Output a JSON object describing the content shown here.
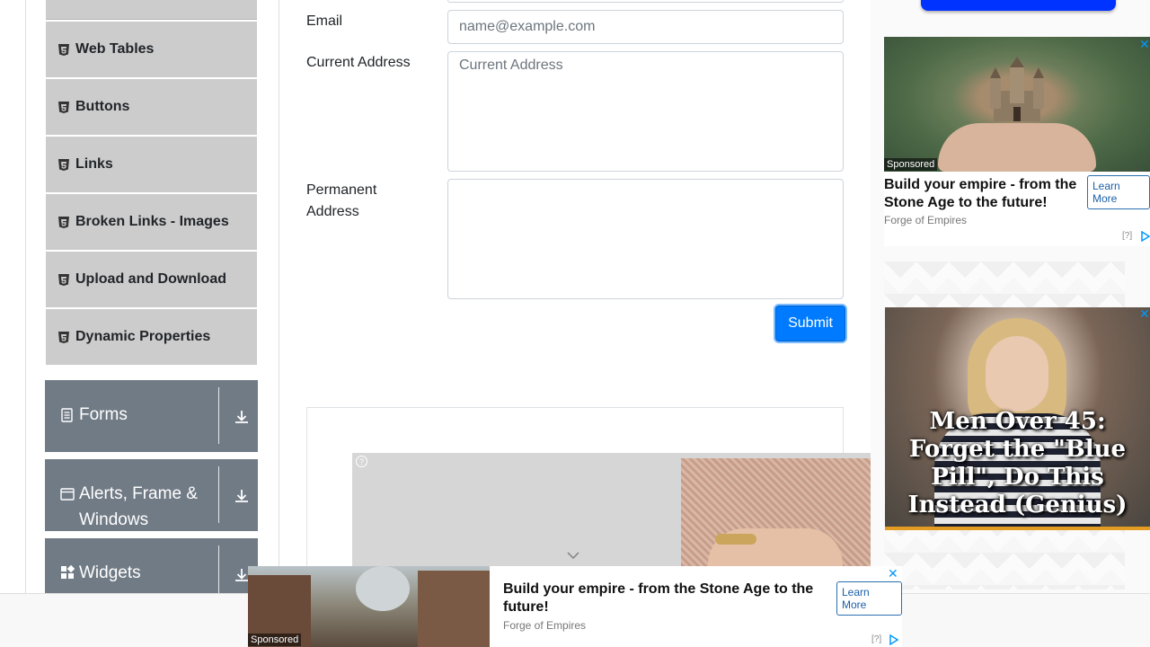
{
  "sidebar": {
    "items": [
      {
        "label": "Web Tables"
      },
      {
        "label": "Buttons"
      },
      {
        "label": "Links"
      },
      {
        "label": "Broken Links - Images"
      },
      {
        "label": "Upload and Download"
      },
      {
        "label": "Dynamic Properties"
      }
    ],
    "groups": [
      {
        "label": "Forms",
        "icon": "document-icon"
      },
      {
        "label": "Alerts, Frame & Windows",
        "icon": "window-icon"
      },
      {
        "label": "Widgets",
        "icon": "widgets-icon"
      }
    ]
  },
  "form": {
    "email_label": "Email",
    "email_placeholder": "name@example.com",
    "current_address_label": "Current Address",
    "current_address_placeholder": "Current Address",
    "permanent_address_label": "Permanent Address",
    "submit_label": "Submit"
  },
  "ads": {
    "side_ad": {
      "sponsored": "Sponsored",
      "title": "Build your empire - from the Stone Age to the future!",
      "source": "Forge of Empires",
      "cta": "Learn More",
      "adchoices": "[?]"
    },
    "side_ad2": {
      "headline": "Men Over 45: Forget the \"Blue Pill\", Do This Instead (Genius)"
    },
    "bottom_ad": {
      "sponsored": "Sponsored",
      "title": "Build your empire - from the Stone Age to the future!",
      "source": "Forge of Empires",
      "cta": "Learn More",
      "adchoices": "[?]"
    },
    "video_ad": {
      "help": "?"
    }
  },
  "colors": {
    "submit_blue": "#007bff",
    "group_bg": "#717b86",
    "menu_item_bg": "#cccccc",
    "ad_accent": "#0099ff"
  }
}
